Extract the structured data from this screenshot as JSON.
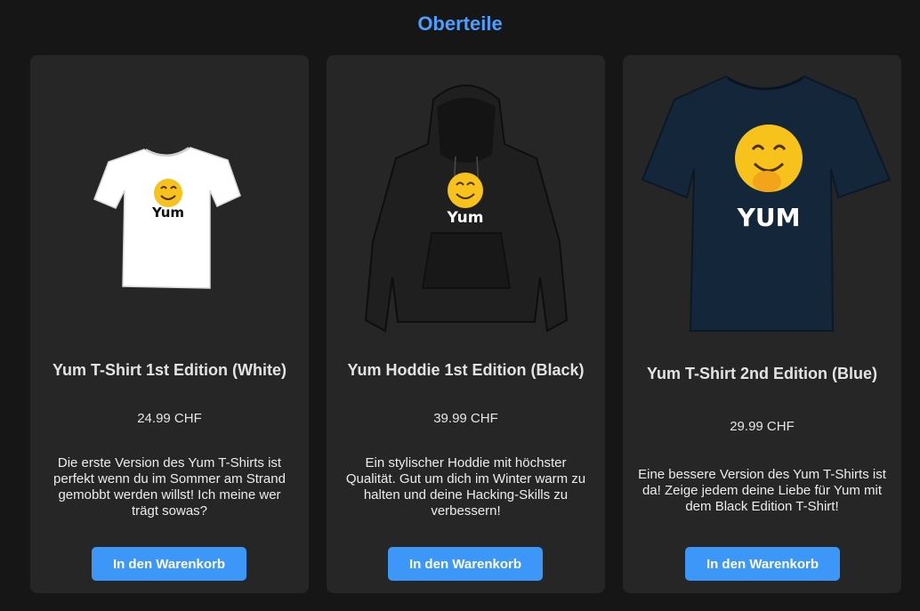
{
  "section": {
    "title": "Oberteile"
  },
  "products": [
    {
      "name": "Yum T-Shirt 1st Edition (White)",
      "price": "24.99 CHF",
      "description": "Die erste Version des Yum T-Shirts ist perfekt wenn du im Sommer am Strand gemobbt werden willst! Ich meine wer trägt sowas?",
      "button_label": "In den Warenkorb",
      "print_text": "Yum",
      "garment_color": "#ffffff"
    },
    {
      "name": "Yum Hoddie 1st Edition (Black)",
      "price": "39.99 CHF",
      "description": "Ein stylischer Hoddie mit höchster Qualität. Gut um dich im Winter warm zu halten und deine Hacking-Skills zu verbessern!",
      "button_label": "In den Warenkorb",
      "print_text": "Yum",
      "garment_color": "#1f1f1f"
    },
    {
      "name": "Yum T-Shirt 2nd Edition (Blue)",
      "price": "29.99 CHF",
      "description": "Eine bessere Version des Yum T-Shirts ist da! Zeige jedem deine Liebe für Yum mit dem Black Edition T-Shirt!",
      "button_label": "In den Warenkorb",
      "print_text": "YUM",
      "garment_color": "#14263a"
    }
  ],
  "colors": {
    "background": "#161616",
    "card": "#262626",
    "accent": "#4d9fff",
    "button": "#3d97f8"
  }
}
